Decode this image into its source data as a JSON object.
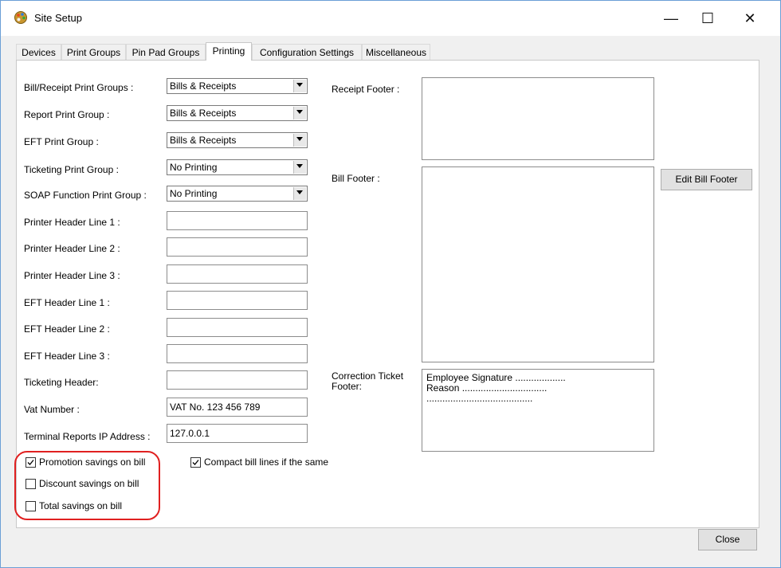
{
  "window": {
    "title": "Site Setup",
    "icon": "palette-icon",
    "controls": {
      "minimize": "—",
      "maximize": "☐",
      "close": "✕"
    }
  },
  "tabs": [
    {
      "label": "Devices"
    },
    {
      "label": "Print Groups"
    },
    {
      "label": "Pin Pad Groups"
    },
    {
      "label": "Printing",
      "active": true
    },
    {
      "label": "Configuration Settings"
    },
    {
      "label": "Miscellaneous"
    }
  ],
  "form": {
    "bill_receipt_print_groups": {
      "label": "Bill/Receipt Print Groups :",
      "value": "Bills & Receipts"
    },
    "report_print_group": {
      "label": "Report Print Group :",
      "value": "Bills & Receipts"
    },
    "eft_print_group": {
      "label": "EFT Print Group :",
      "value": "Bills & Receipts"
    },
    "ticketing_print_group": {
      "label": "Ticketing Print Group :",
      "value": "No Printing"
    },
    "soap_function_print_group": {
      "label": "SOAP Function Print Group :",
      "value": "No Printing"
    },
    "printer_header_line_1": {
      "label": "Printer Header Line 1 :",
      "value": ""
    },
    "printer_header_line_2": {
      "label": "Printer Header Line 2 :",
      "value": ""
    },
    "printer_header_line_3": {
      "label": "Printer Header Line 3 :",
      "value": ""
    },
    "eft_header_line_1": {
      "label": "EFT Header Line 1 :",
      "value": ""
    },
    "eft_header_line_2": {
      "label": "EFT Header Line 2 :",
      "value": ""
    },
    "eft_header_line_3": {
      "label": "EFT Header Line 3 :",
      "value": ""
    },
    "ticketing_header": {
      "label": "Ticketing Header:",
      "value": ""
    },
    "vat_number": {
      "label": "Vat Number :",
      "value": "VAT No. 123 456 789"
    },
    "terminal_reports_ip": {
      "label": "Terminal Reports IP Address :",
      "value": "127.0.0.1"
    }
  },
  "footers": {
    "receipt_footer": {
      "label": "Receipt Footer :",
      "value": ""
    },
    "bill_footer": {
      "label": "Bill Footer :",
      "value": ""
    },
    "edit_bill_footer_button": "Edit Bill Footer",
    "correction_ticket_footer": {
      "label_line1": "Correction Ticket",
      "label_line2": "Footer:",
      "line1": "Employee Signature ...................",
      "line2": "Reason ................................",
      "line3": "........................................"
    }
  },
  "checkboxes": {
    "promotion_savings": {
      "label": "Promotion savings on bill",
      "checked": true
    },
    "discount_savings": {
      "label": "Discount savings on bill",
      "checked": false
    },
    "total_savings": {
      "label": "Total savings on bill",
      "checked": false
    },
    "compact_bill_lines": {
      "label": "Compact bill lines if the same",
      "checked": true
    }
  },
  "close_button": "Close",
  "colors": {
    "highlight": "#e02020",
    "window_border": "#6b9fd6"
  }
}
